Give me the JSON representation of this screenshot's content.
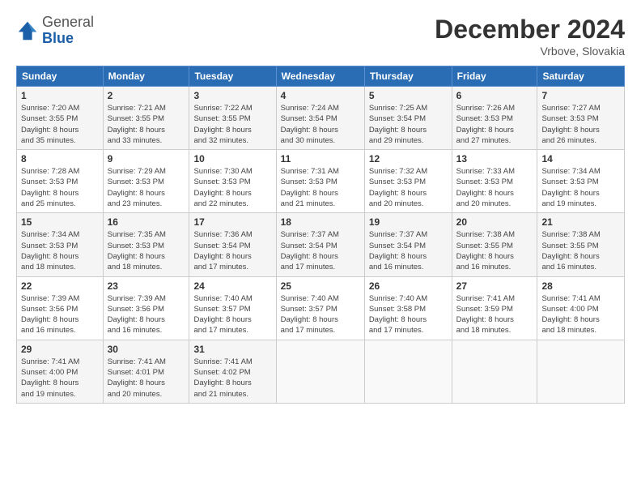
{
  "logo": {
    "general": "General",
    "blue": "Blue"
  },
  "title": "December 2024",
  "location": "Vrbove, Slovakia",
  "days_header": [
    "Sunday",
    "Monday",
    "Tuesday",
    "Wednesday",
    "Thursday",
    "Friday",
    "Saturday"
  ],
  "weeks": [
    [
      {
        "num": "1",
        "info": "Sunrise: 7:20 AM\nSunset: 3:55 PM\nDaylight: 8 hours\nand 35 minutes."
      },
      {
        "num": "2",
        "info": "Sunrise: 7:21 AM\nSunset: 3:55 PM\nDaylight: 8 hours\nand 33 minutes."
      },
      {
        "num": "3",
        "info": "Sunrise: 7:22 AM\nSunset: 3:55 PM\nDaylight: 8 hours\nand 32 minutes."
      },
      {
        "num": "4",
        "info": "Sunrise: 7:24 AM\nSunset: 3:54 PM\nDaylight: 8 hours\nand 30 minutes."
      },
      {
        "num": "5",
        "info": "Sunrise: 7:25 AM\nSunset: 3:54 PM\nDaylight: 8 hours\nand 29 minutes."
      },
      {
        "num": "6",
        "info": "Sunrise: 7:26 AM\nSunset: 3:53 PM\nDaylight: 8 hours\nand 27 minutes."
      },
      {
        "num": "7",
        "info": "Sunrise: 7:27 AM\nSunset: 3:53 PM\nDaylight: 8 hours\nand 26 minutes."
      }
    ],
    [
      {
        "num": "8",
        "info": "Sunrise: 7:28 AM\nSunset: 3:53 PM\nDaylight: 8 hours\nand 25 minutes."
      },
      {
        "num": "9",
        "info": "Sunrise: 7:29 AM\nSunset: 3:53 PM\nDaylight: 8 hours\nand 23 minutes."
      },
      {
        "num": "10",
        "info": "Sunrise: 7:30 AM\nSunset: 3:53 PM\nDaylight: 8 hours\nand 22 minutes."
      },
      {
        "num": "11",
        "info": "Sunrise: 7:31 AM\nSunset: 3:53 PM\nDaylight: 8 hours\nand 21 minutes."
      },
      {
        "num": "12",
        "info": "Sunrise: 7:32 AM\nSunset: 3:53 PM\nDaylight: 8 hours\nand 20 minutes."
      },
      {
        "num": "13",
        "info": "Sunrise: 7:33 AM\nSunset: 3:53 PM\nDaylight: 8 hours\nand 20 minutes."
      },
      {
        "num": "14",
        "info": "Sunrise: 7:34 AM\nSunset: 3:53 PM\nDaylight: 8 hours\nand 19 minutes."
      }
    ],
    [
      {
        "num": "15",
        "info": "Sunrise: 7:34 AM\nSunset: 3:53 PM\nDaylight: 8 hours\nand 18 minutes."
      },
      {
        "num": "16",
        "info": "Sunrise: 7:35 AM\nSunset: 3:53 PM\nDaylight: 8 hours\nand 18 minutes."
      },
      {
        "num": "17",
        "info": "Sunrise: 7:36 AM\nSunset: 3:54 PM\nDaylight: 8 hours\nand 17 minutes."
      },
      {
        "num": "18",
        "info": "Sunrise: 7:37 AM\nSunset: 3:54 PM\nDaylight: 8 hours\nand 17 minutes."
      },
      {
        "num": "19",
        "info": "Sunrise: 7:37 AM\nSunset: 3:54 PM\nDaylight: 8 hours\nand 16 minutes."
      },
      {
        "num": "20",
        "info": "Sunrise: 7:38 AM\nSunset: 3:55 PM\nDaylight: 8 hours\nand 16 minutes."
      },
      {
        "num": "21",
        "info": "Sunrise: 7:38 AM\nSunset: 3:55 PM\nDaylight: 8 hours\nand 16 minutes."
      }
    ],
    [
      {
        "num": "22",
        "info": "Sunrise: 7:39 AM\nSunset: 3:56 PM\nDaylight: 8 hours\nand 16 minutes."
      },
      {
        "num": "23",
        "info": "Sunrise: 7:39 AM\nSunset: 3:56 PM\nDaylight: 8 hours\nand 16 minutes."
      },
      {
        "num": "24",
        "info": "Sunrise: 7:40 AM\nSunset: 3:57 PM\nDaylight: 8 hours\nand 17 minutes."
      },
      {
        "num": "25",
        "info": "Sunrise: 7:40 AM\nSunset: 3:57 PM\nDaylight: 8 hours\nand 17 minutes."
      },
      {
        "num": "26",
        "info": "Sunrise: 7:40 AM\nSunset: 3:58 PM\nDaylight: 8 hours\nand 17 minutes."
      },
      {
        "num": "27",
        "info": "Sunrise: 7:41 AM\nSunset: 3:59 PM\nDaylight: 8 hours\nand 18 minutes."
      },
      {
        "num": "28",
        "info": "Sunrise: 7:41 AM\nSunset: 4:00 PM\nDaylight: 8 hours\nand 18 minutes."
      }
    ],
    [
      {
        "num": "29",
        "info": "Sunrise: 7:41 AM\nSunset: 4:00 PM\nDaylight: 8 hours\nand 19 minutes."
      },
      {
        "num": "30",
        "info": "Sunrise: 7:41 AM\nSunset: 4:01 PM\nDaylight: 8 hours\nand 20 minutes."
      },
      {
        "num": "31",
        "info": "Sunrise: 7:41 AM\nSunset: 4:02 PM\nDaylight: 8 hours\nand 21 minutes."
      },
      null,
      null,
      null,
      null
    ]
  ]
}
